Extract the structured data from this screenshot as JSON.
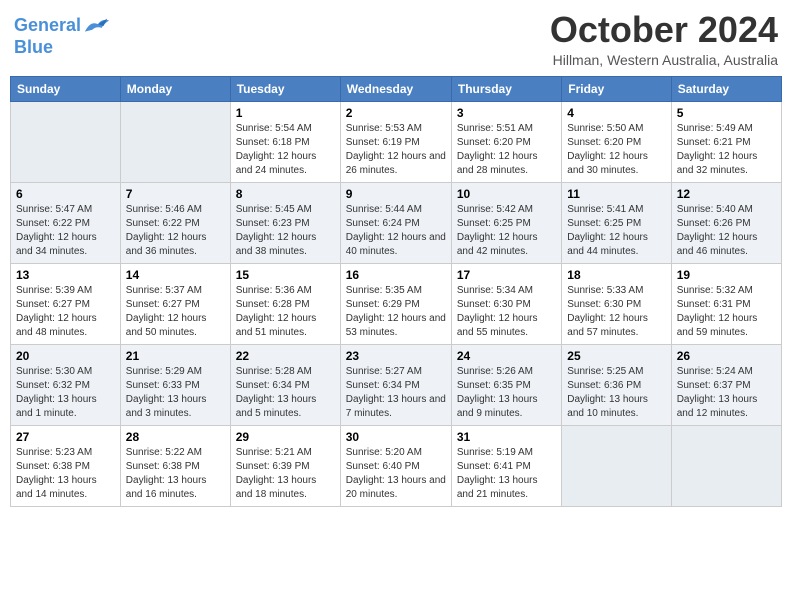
{
  "header": {
    "logo_line1": "General",
    "logo_line2": "Blue",
    "month": "October 2024",
    "location": "Hillman, Western Australia, Australia"
  },
  "days_of_week": [
    "Sunday",
    "Monday",
    "Tuesday",
    "Wednesday",
    "Thursday",
    "Friday",
    "Saturday"
  ],
  "weeks": [
    [
      {
        "day": "",
        "sunrise": "",
        "sunset": "",
        "daylight": ""
      },
      {
        "day": "",
        "sunrise": "",
        "sunset": "",
        "daylight": ""
      },
      {
        "day": "1",
        "sunrise": "Sunrise: 5:54 AM",
        "sunset": "Sunset: 6:18 PM",
        "daylight": "Daylight: 12 hours and 24 minutes."
      },
      {
        "day": "2",
        "sunrise": "Sunrise: 5:53 AM",
        "sunset": "Sunset: 6:19 PM",
        "daylight": "Daylight: 12 hours and 26 minutes."
      },
      {
        "day": "3",
        "sunrise": "Sunrise: 5:51 AM",
        "sunset": "Sunset: 6:20 PM",
        "daylight": "Daylight: 12 hours and 28 minutes."
      },
      {
        "day": "4",
        "sunrise": "Sunrise: 5:50 AM",
        "sunset": "Sunset: 6:20 PM",
        "daylight": "Daylight: 12 hours and 30 minutes."
      },
      {
        "day": "5",
        "sunrise": "Sunrise: 5:49 AM",
        "sunset": "Sunset: 6:21 PM",
        "daylight": "Daylight: 12 hours and 32 minutes."
      }
    ],
    [
      {
        "day": "6",
        "sunrise": "Sunrise: 5:47 AM",
        "sunset": "Sunset: 6:22 PM",
        "daylight": "Daylight: 12 hours and 34 minutes."
      },
      {
        "day": "7",
        "sunrise": "Sunrise: 5:46 AM",
        "sunset": "Sunset: 6:22 PM",
        "daylight": "Daylight: 12 hours and 36 minutes."
      },
      {
        "day": "8",
        "sunrise": "Sunrise: 5:45 AM",
        "sunset": "Sunset: 6:23 PM",
        "daylight": "Daylight: 12 hours and 38 minutes."
      },
      {
        "day": "9",
        "sunrise": "Sunrise: 5:44 AM",
        "sunset": "Sunset: 6:24 PM",
        "daylight": "Daylight: 12 hours and 40 minutes."
      },
      {
        "day": "10",
        "sunrise": "Sunrise: 5:42 AM",
        "sunset": "Sunset: 6:25 PM",
        "daylight": "Daylight: 12 hours and 42 minutes."
      },
      {
        "day": "11",
        "sunrise": "Sunrise: 5:41 AM",
        "sunset": "Sunset: 6:25 PM",
        "daylight": "Daylight: 12 hours and 44 minutes."
      },
      {
        "day": "12",
        "sunrise": "Sunrise: 5:40 AM",
        "sunset": "Sunset: 6:26 PM",
        "daylight": "Daylight: 12 hours and 46 minutes."
      }
    ],
    [
      {
        "day": "13",
        "sunrise": "Sunrise: 5:39 AM",
        "sunset": "Sunset: 6:27 PM",
        "daylight": "Daylight: 12 hours and 48 minutes."
      },
      {
        "day": "14",
        "sunrise": "Sunrise: 5:37 AM",
        "sunset": "Sunset: 6:27 PM",
        "daylight": "Daylight: 12 hours and 50 minutes."
      },
      {
        "day": "15",
        "sunrise": "Sunrise: 5:36 AM",
        "sunset": "Sunset: 6:28 PM",
        "daylight": "Daylight: 12 hours and 51 minutes."
      },
      {
        "day": "16",
        "sunrise": "Sunrise: 5:35 AM",
        "sunset": "Sunset: 6:29 PM",
        "daylight": "Daylight: 12 hours and 53 minutes."
      },
      {
        "day": "17",
        "sunrise": "Sunrise: 5:34 AM",
        "sunset": "Sunset: 6:30 PM",
        "daylight": "Daylight: 12 hours and 55 minutes."
      },
      {
        "day": "18",
        "sunrise": "Sunrise: 5:33 AM",
        "sunset": "Sunset: 6:30 PM",
        "daylight": "Daylight: 12 hours and 57 minutes."
      },
      {
        "day": "19",
        "sunrise": "Sunrise: 5:32 AM",
        "sunset": "Sunset: 6:31 PM",
        "daylight": "Daylight: 12 hours and 59 minutes."
      }
    ],
    [
      {
        "day": "20",
        "sunrise": "Sunrise: 5:30 AM",
        "sunset": "Sunset: 6:32 PM",
        "daylight": "Daylight: 13 hours and 1 minute."
      },
      {
        "day": "21",
        "sunrise": "Sunrise: 5:29 AM",
        "sunset": "Sunset: 6:33 PM",
        "daylight": "Daylight: 13 hours and 3 minutes."
      },
      {
        "day": "22",
        "sunrise": "Sunrise: 5:28 AM",
        "sunset": "Sunset: 6:34 PM",
        "daylight": "Daylight: 13 hours and 5 minutes."
      },
      {
        "day": "23",
        "sunrise": "Sunrise: 5:27 AM",
        "sunset": "Sunset: 6:34 PM",
        "daylight": "Daylight: 13 hours and 7 minutes."
      },
      {
        "day": "24",
        "sunrise": "Sunrise: 5:26 AM",
        "sunset": "Sunset: 6:35 PM",
        "daylight": "Daylight: 13 hours and 9 minutes."
      },
      {
        "day": "25",
        "sunrise": "Sunrise: 5:25 AM",
        "sunset": "Sunset: 6:36 PM",
        "daylight": "Daylight: 13 hours and 10 minutes."
      },
      {
        "day": "26",
        "sunrise": "Sunrise: 5:24 AM",
        "sunset": "Sunset: 6:37 PM",
        "daylight": "Daylight: 13 hours and 12 minutes."
      }
    ],
    [
      {
        "day": "27",
        "sunrise": "Sunrise: 5:23 AM",
        "sunset": "Sunset: 6:38 PM",
        "daylight": "Daylight: 13 hours and 14 minutes."
      },
      {
        "day": "28",
        "sunrise": "Sunrise: 5:22 AM",
        "sunset": "Sunset: 6:38 PM",
        "daylight": "Daylight: 13 hours and 16 minutes."
      },
      {
        "day": "29",
        "sunrise": "Sunrise: 5:21 AM",
        "sunset": "Sunset: 6:39 PM",
        "daylight": "Daylight: 13 hours and 18 minutes."
      },
      {
        "day": "30",
        "sunrise": "Sunrise: 5:20 AM",
        "sunset": "Sunset: 6:40 PM",
        "daylight": "Daylight: 13 hours and 20 minutes."
      },
      {
        "day": "31",
        "sunrise": "Sunrise: 5:19 AM",
        "sunset": "Sunset: 6:41 PM",
        "daylight": "Daylight: 13 hours and 21 minutes."
      },
      {
        "day": "",
        "sunrise": "",
        "sunset": "",
        "daylight": ""
      },
      {
        "day": "",
        "sunrise": "",
        "sunset": "",
        "daylight": ""
      }
    ]
  ]
}
